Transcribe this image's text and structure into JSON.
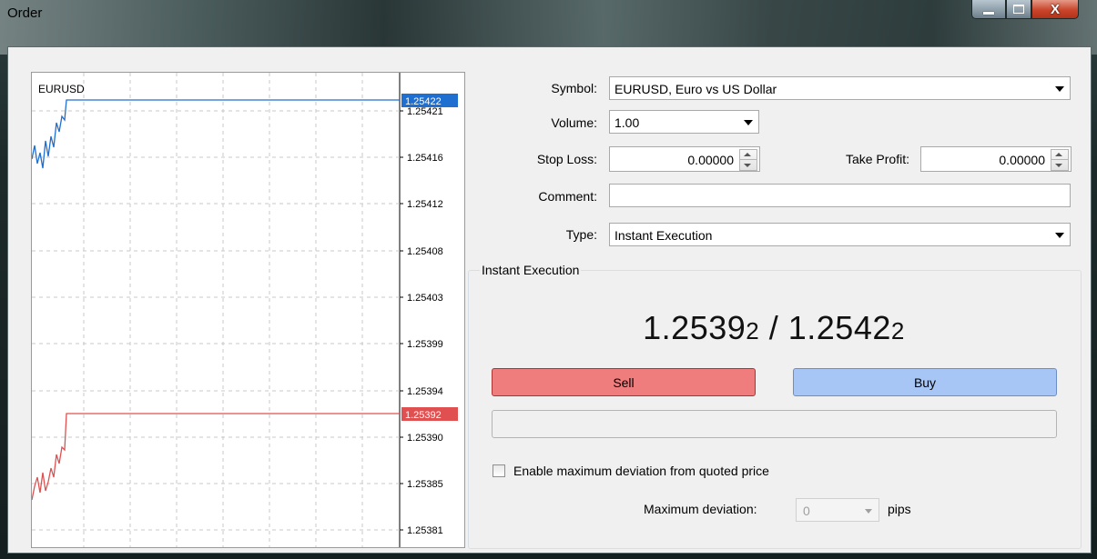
{
  "window": {
    "title": "Order",
    "minimize_icon": "minimize-icon",
    "maximize_icon": "maximize-icon",
    "close_label": "X"
  },
  "chart": {
    "symbol": "EURUSD",
    "price_labels": [
      "1.25421",
      "1.25416",
      "1.25412",
      "1.25408",
      "1.25403",
      "1.25399",
      "1.25394",
      "1.25390",
      "1.25385",
      "1.25381"
    ],
    "ask_tag": "1.25422",
    "bid_tag": "1.25392",
    "ask_color": "#1f6fd0",
    "bid_color": "#e05050"
  },
  "form": {
    "symbol_label": "Symbol:",
    "symbol_value": "EURUSD, Euro vs US Dollar",
    "volume_label": "Volume:",
    "volume_value": "1.00",
    "stoploss_label": "Stop Loss:",
    "stoploss_value": "0.00000",
    "takeprofit_label": "Take Profit:",
    "takeprofit_value": "0.00000",
    "comment_label": "Comment:",
    "comment_value": "",
    "type_label": "Type:",
    "type_value": "Instant Execution"
  },
  "execution": {
    "group_title": "Instant Execution",
    "bid_main": "1.2539",
    "bid_pip": "2",
    "separator": " / ",
    "ask_main": "1.2542",
    "ask_pip": "2",
    "sell_label": "Sell",
    "buy_label": "Buy",
    "sell_color": "#f07d7d",
    "buy_color": "#a7c6f5",
    "deviation_checkbox_label": "Enable maximum deviation from quoted price",
    "deviation_checked": false,
    "max_deviation_label": "Maximum deviation:",
    "max_deviation_value": "0",
    "pips_label": "pips"
  }
}
